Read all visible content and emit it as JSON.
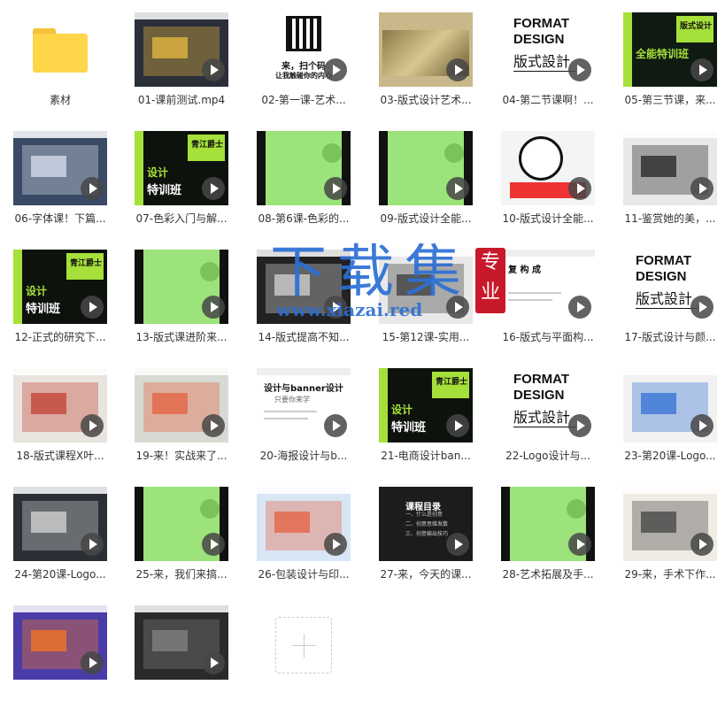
{
  "folder": {
    "label": "素材"
  },
  "files": [
    {
      "label": "01-课前测试.mp4",
      "bg": "#2a2f3a",
      "accent": "#f0c040",
      "style": "screen"
    },
    {
      "label": "02-第一课-艺术...",
      "bg": "#ffffff",
      "accent": "#111111",
      "style": "qr",
      "texts": [
        "来，扫个码",
        "让我触碰你的内心"
      ]
    },
    {
      "label": "03-版式设计艺术...",
      "bg": "#c9b889",
      "accent": "#7a6a3a",
      "style": "painting"
    },
    {
      "label": "04-第二节课啊！...",
      "bg": "#ffffff",
      "accent": "#111111",
      "style": "format",
      "texts": [
        "FORMAT",
        "DESIGN",
        "版式設計"
      ]
    },
    {
      "label": "05-第三节课，来...",
      "bg": "#0e1a12",
      "accent": "#a6e03a",
      "style": "green-dark",
      "texts": [
        "版式设计",
        "全能特训班"
      ]
    },
    {
      "label": "06-字体课！下篇...",
      "bg": "#3a4a66",
      "accent": "#dfe7f3",
      "style": "screen"
    },
    {
      "label": "07-色彩入门与解...",
      "bg": "#0d120d",
      "accent": "#a6e03a",
      "style": "green-dark",
      "texts": [
        "青江爵士",
        "设计",
        "特训班"
      ]
    },
    {
      "label": "08-第6课-色彩的...",
      "bg": "#9be37a",
      "accent": "#1a1a1a",
      "style": "green"
    },
    {
      "label": "09-版式设计全能...",
      "bg": "#9be37a",
      "accent": "#1a1a1a",
      "style": "green"
    },
    {
      "label": "10-版式设计全能...",
      "bg": "#f4f4f4",
      "accent": "#111111",
      "style": "illustration"
    },
    {
      "label": "11-鉴赏她的美，...",
      "bg": "#e8e8e8",
      "accent": "#1a1a1a",
      "style": "screen"
    },
    {
      "label": "12-正式的研究下...",
      "bg": "#0d120d",
      "accent": "#a6e03a",
      "style": "green-dark",
      "texts": [
        "青江爵士",
        "设计",
        "特训班"
      ]
    },
    {
      "label": "13-版式课进阶来...",
      "bg": "#9be37a",
      "accent": "#1a1a1a",
      "style": "green"
    },
    {
      "label": "14-版式提高不知...",
      "bg": "#222222",
      "accent": "#dddddd",
      "style": "screen"
    },
    {
      "label": "15-第12课-实用...",
      "bg": "#e8e8e8",
      "accent": "#333333",
      "style": "screen"
    },
    {
      "label": "16-版式与平面构...",
      "bg": "#ffffff",
      "accent": "#333333",
      "style": "doc",
      "texts": [
        "复  构  成"
      ]
    },
    {
      "label": "17-版式设计与颜...",
      "bg": "#ffffff",
      "accent": "#111111",
      "style": "format",
      "texts": [
        "FORMAT",
        "DESIGN",
        "版式設計"
      ]
    },
    {
      "label": "18-版式课程X叶...",
      "bg": "#e9e5de",
      "accent": "#c0392b",
      "style": "screen"
    },
    {
      "label": "19-来！实战来了...",
      "bg": "#d7dad2",
      "accent": "#e65a3a",
      "style": "screen"
    },
    {
      "label": "20-海报设计与b...",
      "bg": "#ffffff",
      "accent": "#111111",
      "style": "doc",
      "texts": [
        "设计与banner设计",
        "只要你来学"
      ]
    },
    {
      "label": "21-电商设计ban...",
      "bg": "#0d120d",
      "accent": "#a6e03a",
      "style": "green-dark",
      "texts": [
        "青江爵士",
        "设计",
        "特训班"
      ]
    },
    {
      "label": "22-Logo设计与...",
      "bg": "#ffffff",
      "accent": "#111111",
      "style": "format",
      "texts": [
        "FORMAT",
        "DESIGN",
        "版式設計"
      ]
    },
    {
      "label": "23-第20课-Logo...",
      "bg": "#f2f2f2",
      "accent": "#2a6bd4",
      "style": "screen"
    },
    {
      "label": "24-第20课-Logo...",
      "bg": "#2a2f36",
      "accent": "#dddddd",
      "style": "screen"
    },
    {
      "label": "25-来，我们来搞...",
      "bg": "#9be37a",
      "accent": "#1a1a1a",
      "style": "green"
    },
    {
      "label": "26-包装设计与印...",
      "bg": "#d9e6f5",
      "accent": "#e65a3a",
      "style": "screen"
    },
    {
      "label": "27-来，今天的课...",
      "bg": "#1c1c1c",
      "accent": "#ffffff",
      "style": "doc-dark",
      "texts": [
        "课程目录",
        "一、什么是创意",
        "二、创意思维发散",
        "三、创意输出技巧"
      ]
    },
    {
      "label": "28-艺术拓展及手...",
      "bg": "#9be37a",
      "accent": "#1a1a1a",
      "style": "green"
    },
    {
      "label": "29-来，手术下作...",
      "bg": "#f0ece4",
      "accent": "#3a3a3a",
      "style": "screen"
    },
    {
      "label": "",
      "bg": "#4a3ca8",
      "accent": "#ff7a1a",
      "style": "screen"
    },
    {
      "label": "",
      "bg": "#2a2a2a",
      "accent": "#888888",
      "style": "screen"
    }
  ],
  "add_button": {
    "icon": "plus-icon"
  },
  "watermark": {
    "title": "下载集",
    "url": "www.xiazai.red",
    "seal": [
      "专",
      "业"
    ],
    "color": "#2c6fd4",
    "seal_color": "#c8192b"
  }
}
